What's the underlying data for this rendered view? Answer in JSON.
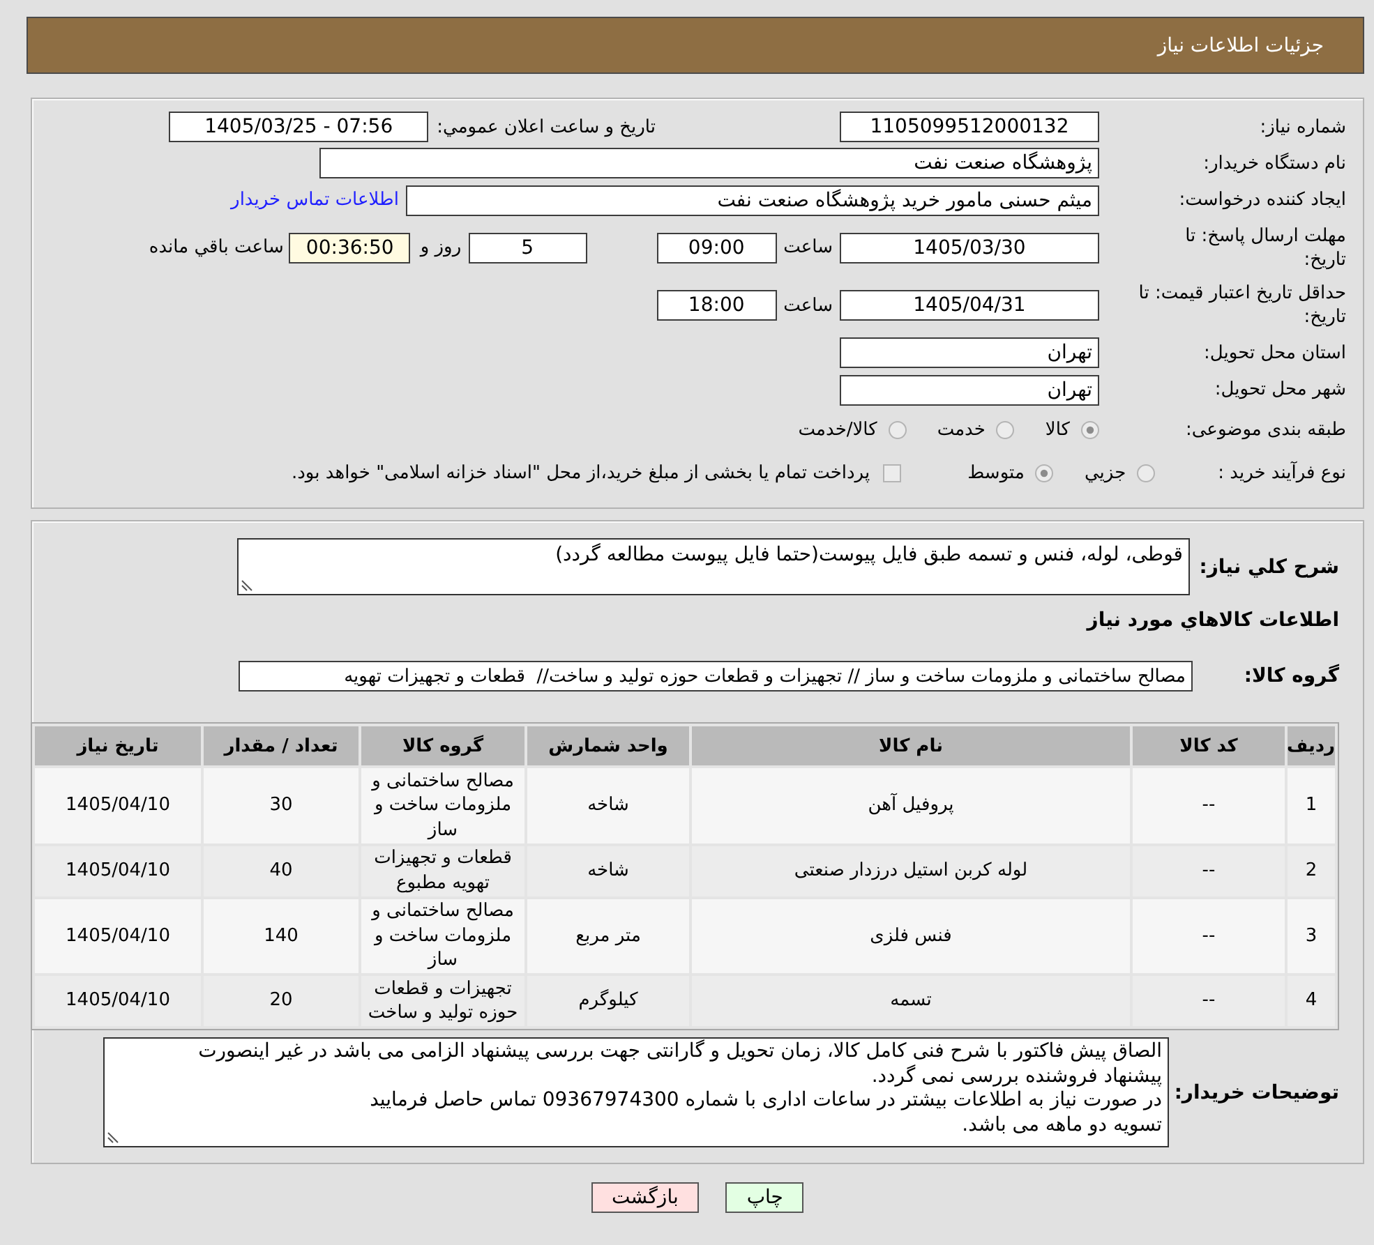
{
  "header": {
    "title": "جزئیات اطلاعات نیاز"
  },
  "details": {
    "need_number": {
      "label": "شماره نیاز:",
      "value": "1105099512000132"
    },
    "announcement": {
      "label": "تاریخ و ساعت اعلان عمومي:",
      "value": "1405/03/25 - 07:56"
    },
    "buyer_org": {
      "label": "نام دستگاه خریدار:",
      "value": "پژوهشگاه صنعت نفت"
    },
    "requester": {
      "label": "ایجاد کننده درخواست:",
      "value": "میثم حسنی مامور خرید پژوهشگاه صنعت نفت",
      "contact_link": "اطلاعات تماس خریدار"
    },
    "reply_deadline": {
      "label": "مهلت ارسال پاسخ: تا تاریخ:",
      "date": "1405/03/30",
      "time_label": "ساعت",
      "time": "09:00",
      "days": "5",
      "days_label": "روز و",
      "remaining": "00:36:50",
      "remaining_label": "ساعت باقي مانده"
    },
    "price_validity": {
      "label": "حداقل تاریخ اعتبار قیمت: تا تاریخ:",
      "date": "1405/04/31",
      "time_label": "ساعت",
      "time": "18:00"
    },
    "province": {
      "label": "استان محل تحویل:",
      "value": "تهران"
    },
    "city": {
      "label": "شهر محل تحویل:",
      "value": "تهران"
    },
    "subject_class": {
      "label": "طبقه بندی موضوعی:",
      "options": [
        {
          "label": "کالا",
          "selected": true
        },
        {
          "label": "خدمت",
          "selected": false
        },
        {
          "label": "کالا/خدمت",
          "selected": false
        }
      ]
    },
    "process_type": {
      "label": "نوع فرآیند خرید :",
      "options": [
        {
          "label": "جزيي",
          "selected": false
        },
        {
          "label": "متوسط",
          "selected": true
        }
      ],
      "treasury_payment": {
        "label": "پرداخت تمام یا بخشی از مبلغ خرید،از محل \"اسناد خزانه اسلامی\" خواهد بود.",
        "checked": false
      }
    }
  },
  "description": {
    "label": "شرح کلي نیاز:",
    "value": "قوطی، لوله، فنس و تسمه طبق فایل پیوست(حتما فایل پیوست مطالعه گردد)"
  },
  "items": {
    "title": "اطلاعات کالاهاي مورد نیاز",
    "group": {
      "label": "گروه کالا:",
      "value": "مصالح ساختمانی و ملزومات ساخت و ساز // تجهیزات و قطعات حوزه تولید و ساخت//  قطعات و تجهیزات تهویه"
    },
    "table": {
      "columns": [
        "ردیف",
        "کد کالا",
        "نام کالا",
        "واحد شمارش",
        "گروه کالا",
        "تعداد / مقدار",
        "تاریخ نیاز"
      ],
      "rows": [
        [
          "1",
          "--",
          "پروفیل آهن",
          "شاخه",
          "مصالح ساختمانی و ملزومات ساخت و ساز",
          "30",
          "1405/04/10"
        ],
        [
          "2",
          "--",
          "لوله کربن استیل درزدار صنعتی",
          "شاخه",
          "قطعات و تجهیزات تهویه مطبوع",
          "40",
          "1405/04/10"
        ],
        [
          "3",
          "--",
          "فنس فلزی",
          "متر مربع",
          "مصالح ساختمانی و ملزومات ساخت و ساز",
          "140",
          "1405/04/10"
        ],
        [
          "4",
          "--",
          "تسمه",
          "کیلوگرم",
          "تجهیزات و قطعات حوزه تولید و ساخت",
          "20",
          "1405/04/10"
        ]
      ]
    }
  },
  "buyer_notes": {
    "label": "توضیحات خریدار:",
    "value": "الصاق پیش فاکتور با شرح فنی کامل کالا، زمان تحویل و گارانتی جهت بررسی پیشنهاد الزامی می باشد در غیر اینصورت پیشنهاد فروشنده بررسی نمی گردد.\nدر صورت نیاز به اطلاعات بیشتر در ساعات اداری با شماره 09367974300 تماس حاصل فرمایید\nتسویه دو ماهه می باشد."
  },
  "buttons": [
    {
      "label": "چاپ",
      "kind": "print"
    },
    {
      "label": "بازگشت",
      "kind": "back"
    }
  ]
}
